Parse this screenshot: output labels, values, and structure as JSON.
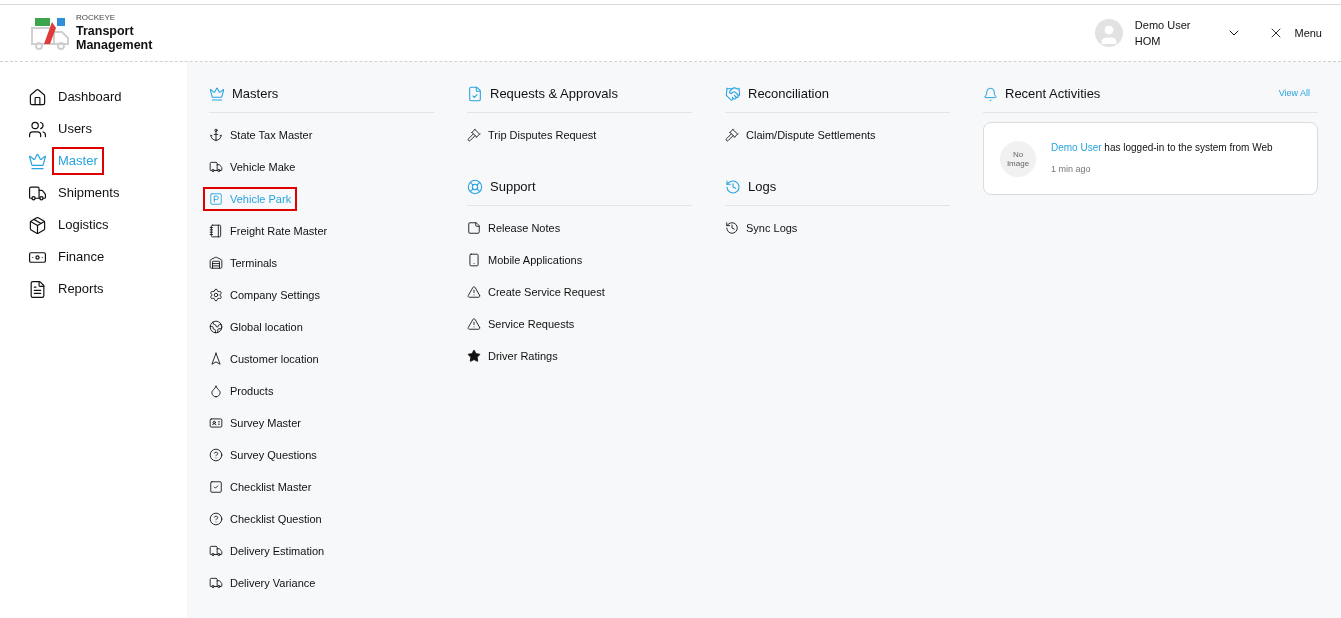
{
  "brand": {
    "small": "ROCKEYE",
    "name": "Transport Management"
  },
  "user": {
    "name": "Demo User",
    "role": "HOM"
  },
  "menu_button": {
    "label": "Menu"
  },
  "sidebar": {
    "items": [
      {
        "label": "Dashboard",
        "selected": false,
        "highlighted": false
      },
      {
        "label": "Users",
        "selected": false,
        "highlighted": false
      },
      {
        "label": "Master",
        "selected": true,
        "highlighted": true
      },
      {
        "label": "Shipments",
        "selected": false,
        "highlighted": false
      },
      {
        "label": "Logistics",
        "selected": false,
        "highlighted": false
      },
      {
        "label": "Finance",
        "selected": false,
        "highlighted": false
      },
      {
        "label": "Reports",
        "selected": false,
        "highlighted": false
      }
    ]
  },
  "menu_columns": [
    {
      "sections": [
        {
          "title": "Masters",
          "items": [
            {
              "label": "State Tax Master",
              "selected": false,
              "highlighted": false
            },
            {
              "label": "Vehicle Make",
              "selected": false,
              "highlighted": false
            },
            {
              "label": "Vehicle Park",
              "selected": true,
              "highlighted": true
            },
            {
              "label": "Freight Rate Master",
              "selected": false,
              "highlighted": false
            },
            {
              "label": "Terminals",
              "selected": false,
              "highlighted": false
            },
            {
              "label": "Company Settings",
              "selected": false,
              "highlighted": false
            },
            {
              "label": "Global location",
              "selected": false,
              "highlighted": false
            },
            {
              "label": "Customer location",
              "selected": false,
              "highlighted": false
            },
            {
              "label": "Products",
              "selected": false,
              "highlighted": false
            },
            {
              "label": "Survey Master",
              "selected": false,
              "highlighted": false
            },
            {
              "label": "Survey Questions",
              "selected": false,
              "highlighted": false
            },
            {
              "label": "Checklist Master",
              "selected": false,
              "highlighted": false
            },
            {
              "label": "Checklist Question",
              "selected": false,
              "highlighted": false
            },
            {
              "label": "Delivery Estimation",
              "selected": false,
              "highlighted": false
            },
            {
              "label": "Delivery Variance",
              "selected": false,
              "highlighted": false
            }
          ]
        }
      ]
    },
    {
      "sections": [
        {
          "title": "Requests & Approvals",
          "items": [
            {
              "label": "Trip Disputes Request",
              "selected": false,
              "highlighted": false
            }
          ]
        },
        {
          "title": "Support",
          "items": [
            {
              "label": "Release Notes",
              "selected": false,
              "highlighted": false
            },
            {
              "label": "Mobile Applications",
              "selected": false,
              "highlighted": false
            },
            {
              "label": "Create Service Request",
              "selected": false,
              "highlighted": false
            },
            {
              "label": "Service Requests",
              "selected": false,
              "highlighted": false
            },
            {
              "label": "Driver Ratings",
              "selected": false,
              "highlighted": false
            }
          ]
        }
      ]
    },
    {
      "sections": [
        {
          "title": "Reconciliation",
          "items": [
            {
              "label": "Claim/Dispute Settlements",
              "selected": false,
              "highlighted": false
            }
          ]
        },
        {
          "title": "Logs",
          "items": [
            {
              "label": "Sync Logs",
              "selected": false,
              "highlighted": false
            }
          ]
        }
      ]
    }
  ],
  "recent_activities": {
    "title": "Recent Activities",
    "view_all": "View All",
    "items": [
      {
        "avatar_text": "No Image",
        "user": "Demo User",
        "text": "has logged-in to the system from Web",
        "time": "1 min ago"
      }
    ]
  }
}
